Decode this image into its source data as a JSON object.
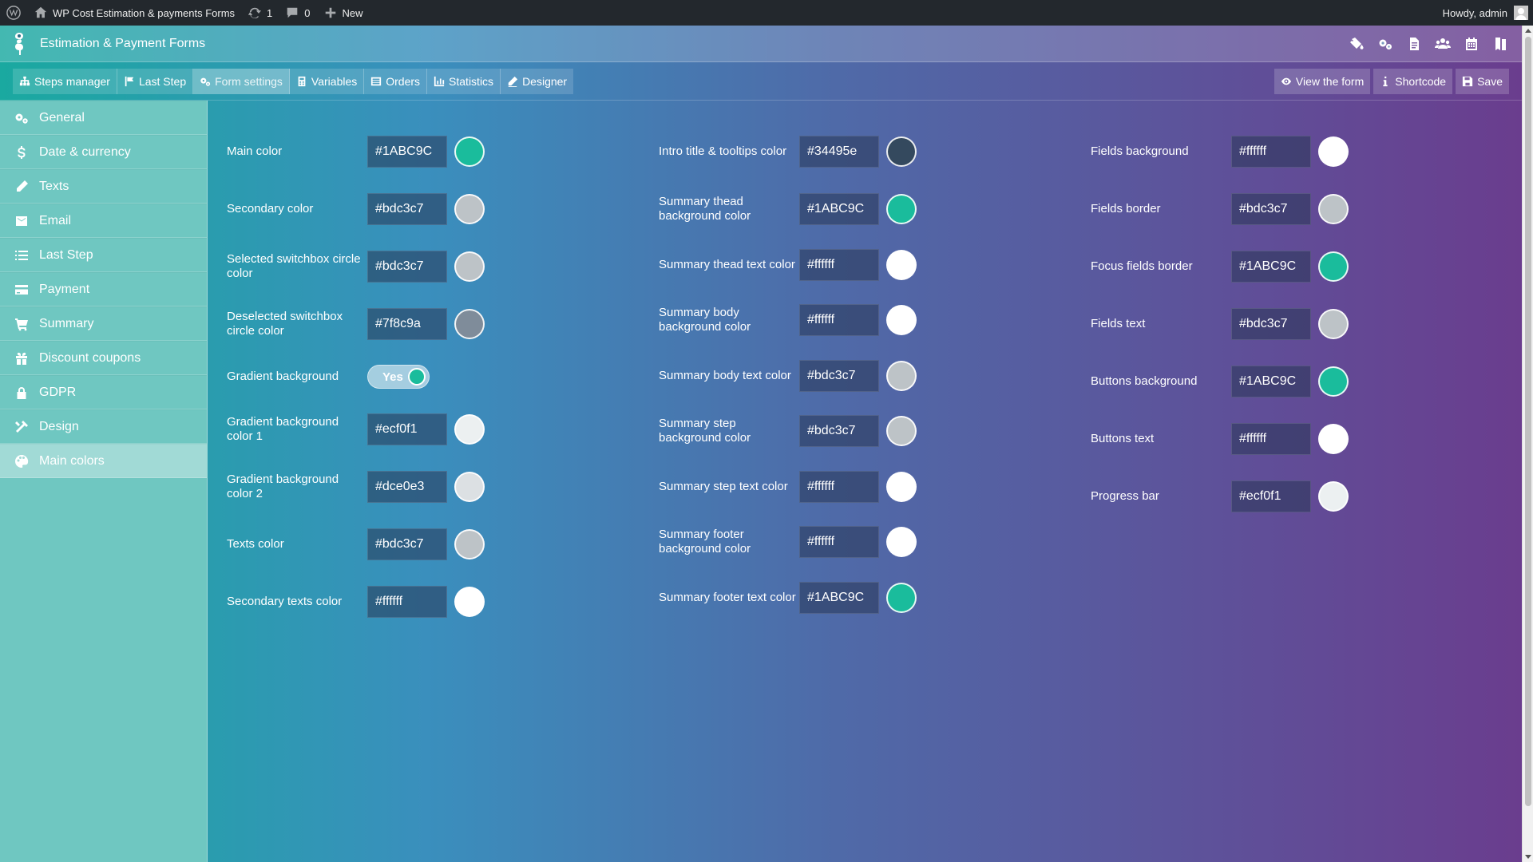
{
  "adminbar": {
    "site_name": "WP Cost Estimation & payments Forms",
    "updates_count": "1",
    "comments_count": "0",
    "new_label": "New",
    "greeting": "Howdy, admin"
  },
  "header": {
    "title": "Estimation & Payment Forms",
    "icons": [
      "paint-bucket-icon",
      "gears-icon",
      "document-icon",
      "users-icon",
      "calendar-icon",
      "book-icon"
    ]
  },
  "tabs": [
    {
      "label": "Steps manager",
      "icon": "sitemap-icon"
    },
    {
      "label": "Last Step",
      "icon": "flag-icon"
    },
    {
      "label": "Form settings",
      "icon": "gears-icon",
      "active": true
    },
    {
      "label": "Variables",
      "icon": "calculator-icon"
    },
    {
      "label": "Orders",
      "icon": "list-icon"
    },
    {
      "label": "Statistics",
      "icon": "chart-icon"
    },
    {
      "label": "Designer",
      "icon": "pencil-icon"
    }
  ],
  "actions": {
    "view": "View the form",
    "shortcode": "Shortcode",
    "save": "Save"
  },
  "sidebar": {
    "items": [
      {
        "label": "General",
        "icon": "gears-icon"
      },
      {
        "label": "Date & currency",
        "icon": "dollar-icon"
      },
      {
        "label": "Texts",
        "icon": "pencil-icon"
      },
      {
        "label": "Email",
        "icon": "envelope-icon"
      },
      {
        "label": "Last Step",
        "icon": "list-icon"
      },
      {
        "label": "Payment",
        "icon": "credit-card-icon"
      },
      {
        "label": "Summary",
        "icon": "cart-icon"
      },
      {
        "label": "Discount coupons",
        "icon": "gift-icon"
      },
      {
        "label": "GDPR",
        "icon": "lock-icon"
      },
      {
        "label": "Design",
        "icon": "tools-icon"
      },
      {
        "label": "Main colors",
        "icon": "palette-icon",
        "active": true
      }
    ]
  },
  "colors": {
    "col1": [
      {
        "label": "Main color",
        "value": "#1ABC9C"
      },
      {
        "label": "Secondary color",
        "value": "#bdc3c7"
      },
      {
        "label": "Selected switchbox circle color",
        "value": "#bdc3c7"
      },
      {
        "label": "Deselected switchbox circle color",
        "value": "#7f8c9a"
      },
      {
        "label": "Gradient background",
        "toggle": "Yes"
      },
      {
        "label": "Gradient background color 1",
        "value": "#ecf0f1"
      },
      {
        "label": "Gradient background color 2",
        "value": "#dce0e3"
      },
      {
        "label": "Texts color",
        "value": "#bdc3c7"
      },
      {
        "label": "Secondary texts color",
        "value": "#ffffff"
      }
    ],
    "col2": [
      {
        "label": "Intro title & tooltips color",
        "value": "#34495e"
      },
      {
        "label": "Summary thead background color",
        "value": "#1ABC9C"
      },
      {
        "label": "Summary thead text color",
        "value": "#ffffff"
      },
      {
        "label": "Summary body background color",
        "value": "#ffffff"
      },
      {
        "label": "Summary body text color",
        "value": "#bdc3c7"
      },
      {
        "label": "Summary step background color",
        "value": "#bdc3c7"
      },
      {
        "label": "Summary step text color",
        "value": "#ffffff"
      },
      {
        "label": "Summary footer background color",
        "value": "#ffffff"
      },
      {
        "label": "Summary footer text color",
        "value": "#1ABC9C"
      }
    ],
    "col3": [
      {
        "label": "Fields background",
        "value": "#ffffff"
      },
      {
        "label": "Fields border",
        "value": "#bdc3c7"
      },
      {
        "label": "Focus fields border",
        "value": "#1ABC9C"
      },
      {
        "label": "Fields text",
        "value": "#bdc3c7"
      },
      {
        "label": "Buttons background",
        "value": "#1ABC9C"
      },
      {
        "label": "Buttons text",
        "value": "#ffffff"
      },
      {
        "label": "Progress bar",
        "value": "#ecf0f1"
      }
    ]
  }
}
